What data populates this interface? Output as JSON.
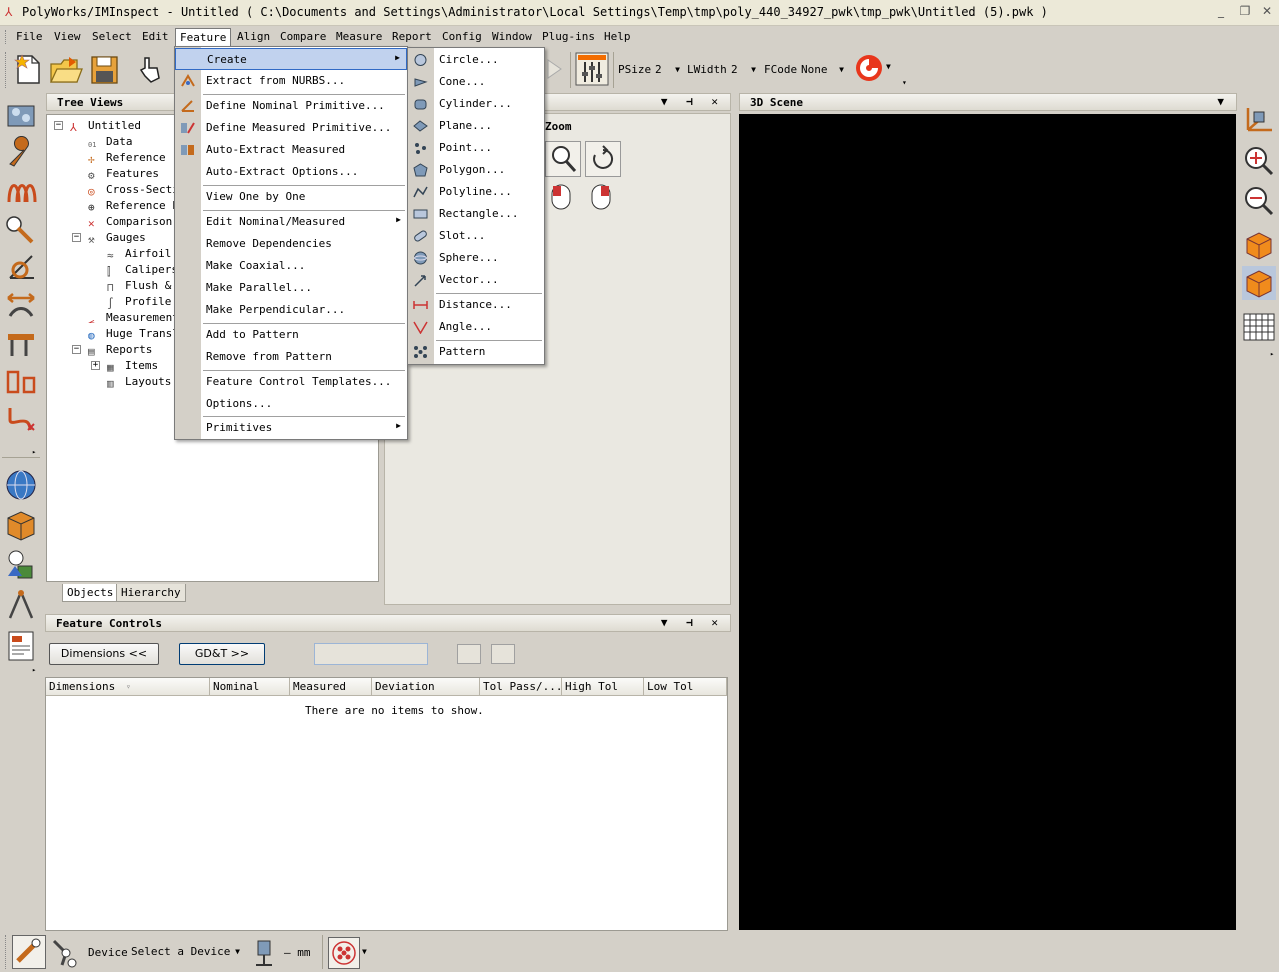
{
  "window": {
    "title": "PolyWorks/IMInspect - Untitled ( C:\\Documents and Settings\\Administrator\\Local Settings\\Temp\\tmp\\poly_440_34927_pwk\\tmp_pwk\\Untitled (5).pwk )",
    "minimize": "_",
    "restore": "❐",
    "close": "✕"
  },
  "menubar": {
    "items": [
      {
        "label": "File"
      },
      {
        "label": "View"
      },
      {
        "label": "Select"
      },
      {
        "label": "Edit"
      },
      {
        "label": "Feature"
      },
      {
        "label": "Align"
      },
      {
        "label": "Compare"
      },
      {
        "label": "Measure"
      },
      {
        "label": "Report"
      },
      {
        "label": "Config"
      },
      {
        "label": "Window"
      },
      {
        "label": "Plug-ins"
      },
      {
        "label": "Help"
      }
    ]
  },
  "toolbar": {
    "psize_label": "PSize",
    "psize_value": "2",
    "lwidth_label": "LWidth",
    "lwidth_value": "2",
    "fcode_label": "FCode",
    "fcode_value": "None"
  },
  "tree_views": {
    "title": "Tree Views",
    "nodes": [
      {
        "label": "Untitled"
      },
      {
        "label": "Data"
      },
      {
        "label": "Reference"
      },
      {
        "label": "Features"
      },
      {
        "label": "Cross-Secti"
      },
      {
        "label": "Reference P"
      },
      {
        "label": "Comparison"
      },
      {
        "label": "Gauges"
      },
      {
        "label": "Airfoil"
      },
      {
        "label": "Calipers"
      },
      {
        "label": "Flush &"
      },
      {
        "label": "Profile"
      },
      {
        "label": "Measurement"
      },
      {
        "label": "Huge Transl"
      },
      {
        "label": "Reports"
      },
      {
        "label": "Items"
      },
      {
        "label": "Layouts"
      }
    ],
    "tabs": [
      {
        "label": "Objects"
      },
      {
        "label": "Hierarchy"
      }
    ]
  },
  "middle_panel": {
    "zoom_label": "Zoom"
  },
  "scene": {
    "title": "3D Scene"
  },
  "feature_controls": {
    "title": "Feature Controls",
    "dimensions_button": "Dimensions <<",
    "gdt_button": "GD&T >>",
    "columns": [
      "Dimensions",
      "Nominal",
      "Measured",
      "Deviation",
      "Tol Pass/...",
      "High Tol",
      "Low Tol"
    ],
    "empty_message": "There are no items to show."
  },
  "feature_menu": {
    "items": [
      {
        "label": "Create",
        "submenu": true
      },
      {
        "label": "Extract from NURBS..."
      },
      {
        "label": "Define Nominal Primitive..."
      },
      {
        "label": "Define Measured Primitive..."
      },
      {
        "label": "Auto-Extract Measured"
      },
      {
        "label": "Auto-Extract Options..."
      },
      {
        "label": "View One by One"
      },
      {
        "label": "Edit Nominal/Measured",
        "submenu": true
      },
      {
        "label": "Remove Dependencies"
      },
      {
        "label": "Make Coaxial..."
      },
      {
        "label": "Make Parallel..."
      },
      {
        "label": "Make Perpendicular..."
      },
      {
        "label": "Add to Pattern"
      },
      {
        "label": "Remove from Pattern"
      },
      {
        "label": "Feature Control Templates..."
      },
      {
        "label": "Options..."
      },
      {
        "label": "Primitives",
        "submenu": true
      }
    ]
  },
  "create_submenu": {
    "items": [
      {
        "label": "Circle..."
      },
      {
        "label": "Cone..."
      },
      {
        "label": "Cylinder..."
      },
      {
        "label": "Plane..."
      },
      {
        "label": "Point..."
      },
      {
        "label": "Polygon..."
      },
      {
        "label": "Polyline..."
      },
      {
        "label": "Rectangle..."
      },
      {
        "label": "Slot..."
      },
      {
        "label": "Sphere..."
      },
      {
        "label": "Vector..."
      },
      {
        "label": "Distance..."
      },
      {
        "label": "Angle..."
      },
      {
        "label": "Pattern"
      }
    ]
  },
  "statusbar": {
    "device_label": "Device",
    "device_value": "Select a Device",
    "unit_value": "— mm"
  }
}
